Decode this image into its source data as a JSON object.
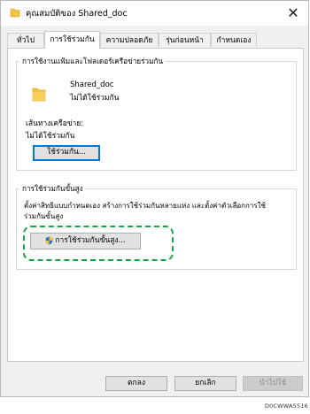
{
  "window": {
    "title": "คุณสมบัติของ Shared_doc",
    "close_glyph": "✕"
  },
  "tabs": [
    {
      "label": "ทั่วไป",
      "active": false
    },
    {
      "label": "การใช้ร่วมกัน",
      "active": true
    },
    {
      "label": "ความปลอดภัย",
      "active": false
    },
    {
      "label": "รุ่นก่อนหน้า",
      "active": false
    },
    {
      "label": "กำหนดเอง",
      "active": false
    }
  ],
  "sharing_group": {
    "title": "การใช้งานแฟ้มและโฟลเดอร์เครือข่ายร่วมกัน",
    "folder_name": "Shared_doc",
    "folder_status": "ไม่ได้ใช้ร่วมกัน",
    "network_path_label": "เส้นทางเครือข่าย:",
    "network_path_value": "ไม่ได้ใช้ร่วมกัน",
    "share_button": "ใช้ร่วมกัน..."
  },
  "advanced_group": {
    "title": "การใช้ร่วมกันขั้นสูง",
    "description_line1": "ตั้งค่าสิทธิแบบกำหนดเอง สร้างการใช้ร่วมกันหลายแห่ง และตั้งค่าตัวเลือกการใช้",
    "description_line2": "ร่วมกันขั้นสูง",
    "advanced_button": "การใช้ร่วมกันขั้นสูง..."
  },
  "footer": {
    "ok": "ตกลง",
    "cancel": "ยกเลิก",
    "apply": "นำไปใช้"
  },
  "image_code": "D0CWWA5516",
  "colors": {
    "highlight_dash": "#1aa44a",
    "folder": "#f5c242",
    "focus_border": "#0078d7"
  }
}
